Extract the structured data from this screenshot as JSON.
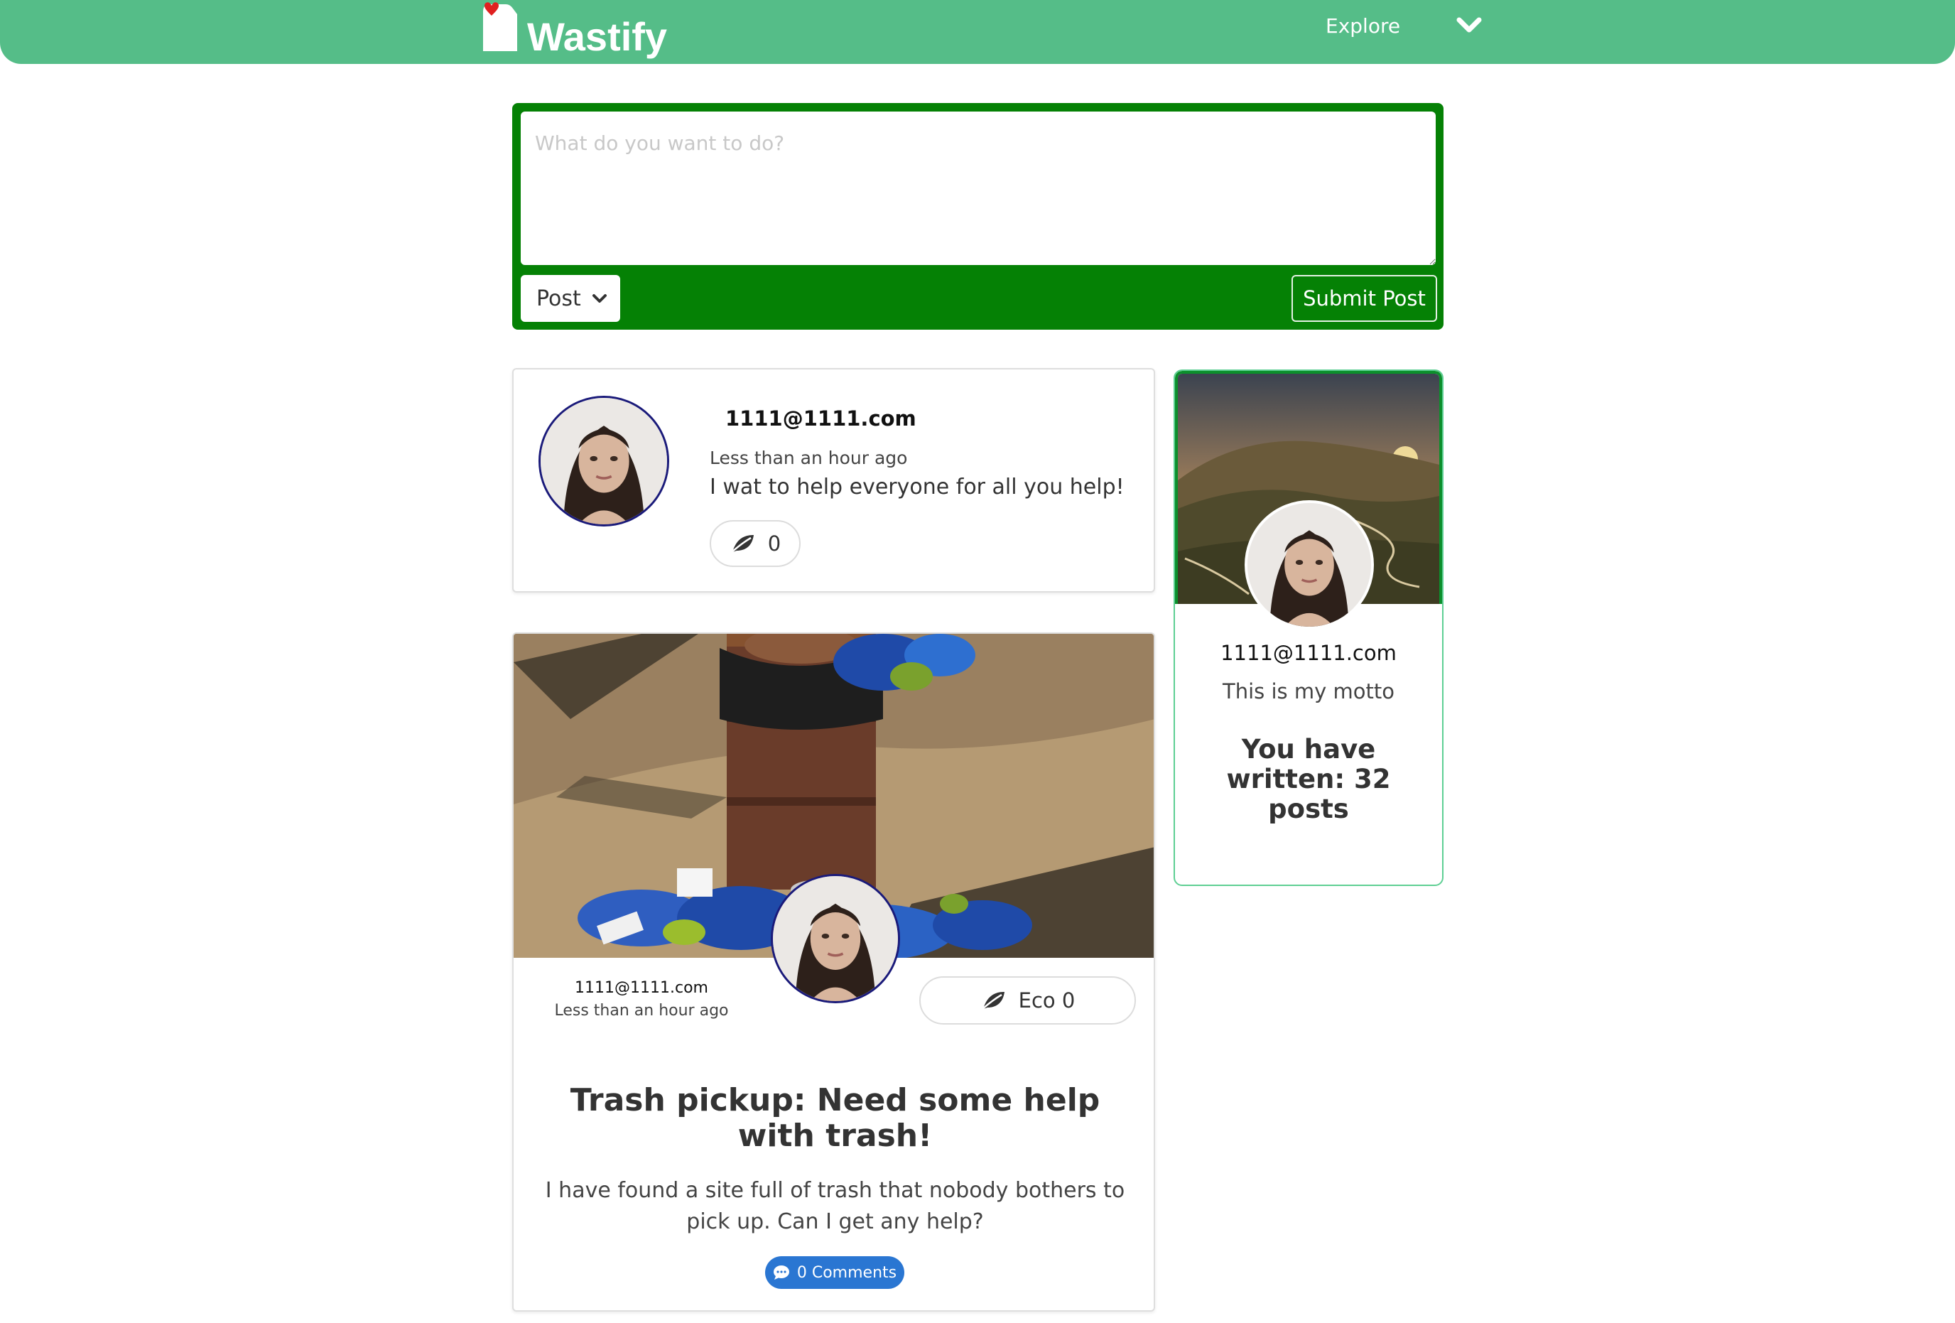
{
  "nav": {
    "brand": "Wastify",
    "explore_label": "Explore",
    "colors": {
      "bar": "#55bd88",
      "heart": "#e02020"
    },
    "icons": [
      "wastify-logo-icon",
      "chevron-down-icon"
    ]
  },
  "composer": {
    "placeholder": "What do you want to do?",
    "value": "",
    "type_selected": "Post",
    "submit_label": "Submit Post",
    "color": "#058105"
  },
  "feed": {
    "posts": [
      {
        "user": "1111@1111.com",
        "time": "Less than an hour ago",
        "text": "I wat to help everyone for all you help!",
        "eco_count": "0"
      },
      {
        "user": "1111@1111.com",
        "time": "Less than an hour ago",
        "eco_label": "Eco 0",
        "title": "Trash pickup: Need some help with trash!",
        "body": "I have found a site full of trash that nobody bothers to pick up. Can I get any help?",
        "comments_label": "0 Comments"
      }
    ]
  },
  "profile": {
    "user": "1111@1111.com",
    "motto": "This is my motto",
    "posts_written": "You have written: 32 posts"
  }
}
